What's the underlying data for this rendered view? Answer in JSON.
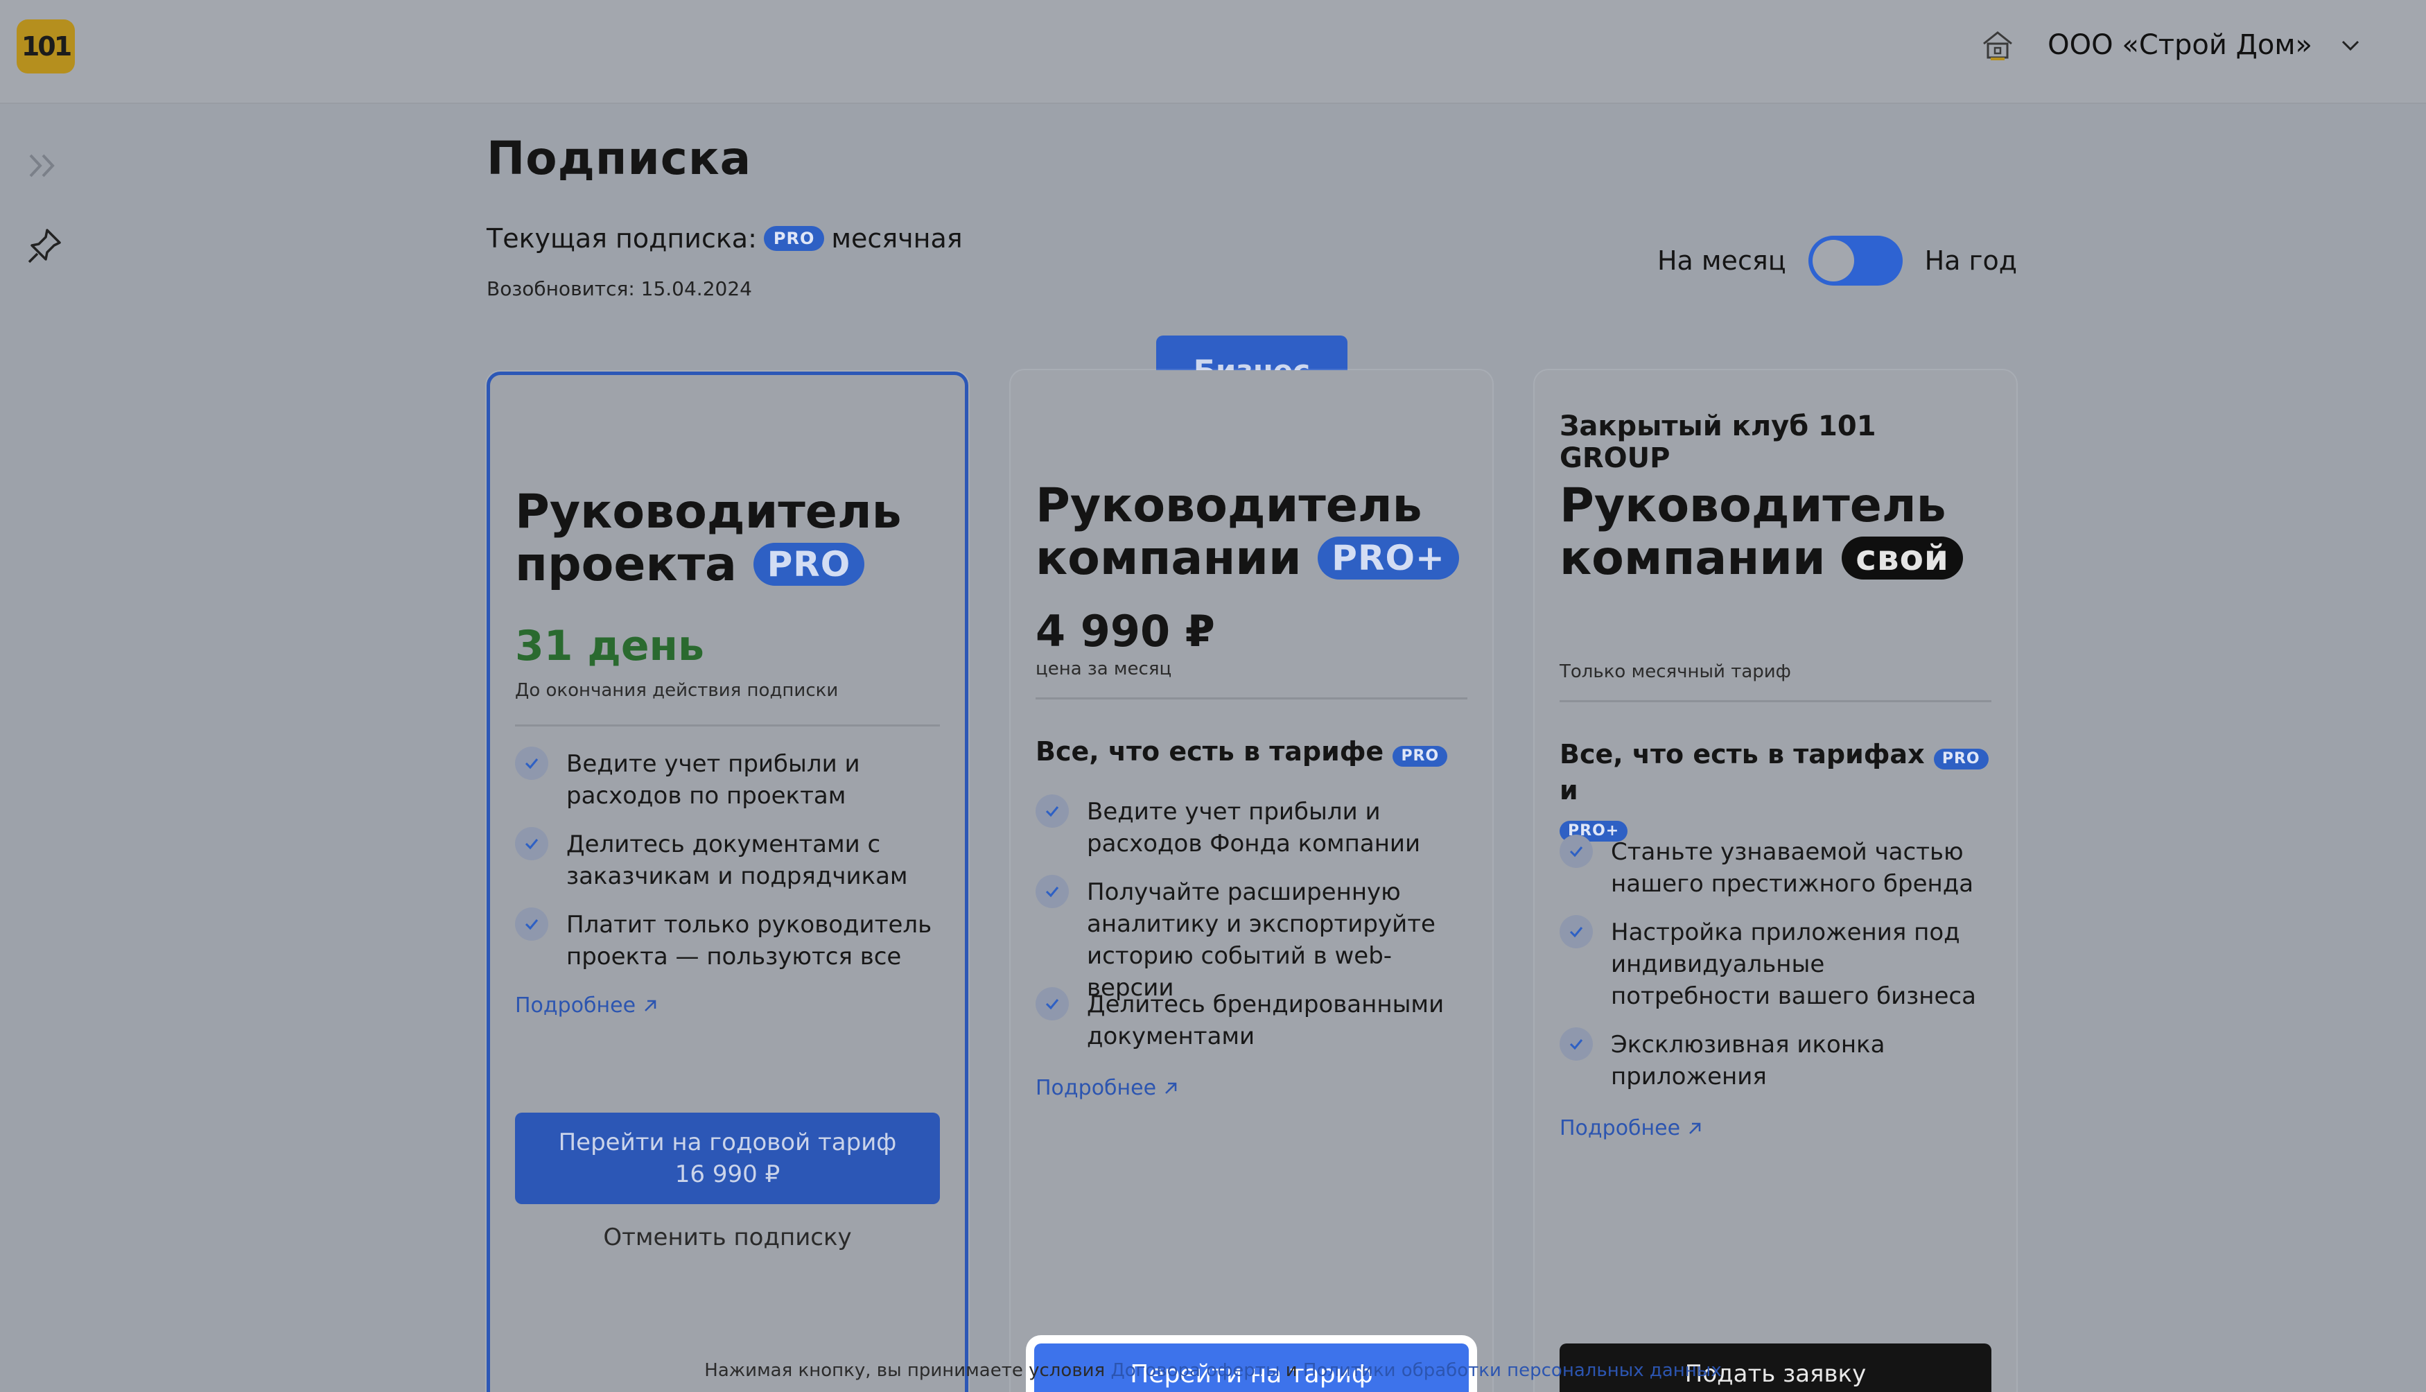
{
  "app": {
    "logo_text": "101",
    "company_name": "ООО «Строй Дом»"
  },
  "page": {
    "title": "Подписка",
    "current_label": "Текущая подписка:",
    "current_badge": "PRO",
    "current_period": "месячная",
    "renew_text": "Возобновится: 15.04.2024"
  },
  "billing_toggle": {
    "left_label": "На месяц",
    "right_label": "На год"
  },
  "plans": [
    {
      "title_line1": "Руководитель",
      "title_line2": "проекта",
      "tag": "PRO",
      "days": "31 день",
      "days_note": "До окончания действия подписки",
      "features": [
        "Ведите учет прибыли и расходов по проектам",
        "Делитесь документами с заказчикам и подрядчикам",
        "Платит только руководитель проекта — пользуются все"
      ],
      "more": "Подробнее",
      "year_button_line1": "Перейти на годовой тариф",
      "year_button_line2": "16 990 ₽",
      "cancel_button": "Отменить подписку"
    },
    {
      "ribbon": "Бизнес",
      "title_line1": "Руководитель",
      "title_line2": "компании",
      "tag": "PRO+",
      "price": "4 990 ₽",
      "price_note": "цена за месяц",
      "features_head": "Все, что есть в тарифе",
      "features_head_badge": "PRO",
      "features": [
        "Ведите учет прибыли и расходов Фонда компании",
        "Получайте расширенную аналитику и экспортируйте историю событий в web-версии",
        "Делитесь брендированными документами"
      ],
      "more": "Подробнее",
      "button": "Перейти на тариф"
    },
    {
      "club": "Закрытый клуб 101 GROUP",
      "title_line1": "Руководитель",
      "title_line2": "компании",
      "tag": "свой",
      "note": "Только месячный тариф",
      "features_head": "Все, что есть в тарифах",
      "features_head_badge1": "PRO",
      "features_head_and": "и",
      "features_head_badge2": "PRO+",
      "features": [
        "Станьте узнаваемой частью нашего престижного бренда",
        "Настройка приложения под индивидуальные потребности вашего бизнеса",
        "Эксклюзивная иконка приложения"
      ],
      "more": "Подробнее",
      "button": "Подать заявку"
    }
  ],
  "footer": {
    "text_before": "Нажимая кнопку, вы принимаете условия",
    "link1": "Договора оферты",
    "text_mid": "и",
    "link2": "Политики обработки персональных данных"
  },
  "colors": {
    "accent": "#3d73eb",
    "pro_badge": "#2e60c4",
    "days_green": "#2a6a2f"
  }
}
